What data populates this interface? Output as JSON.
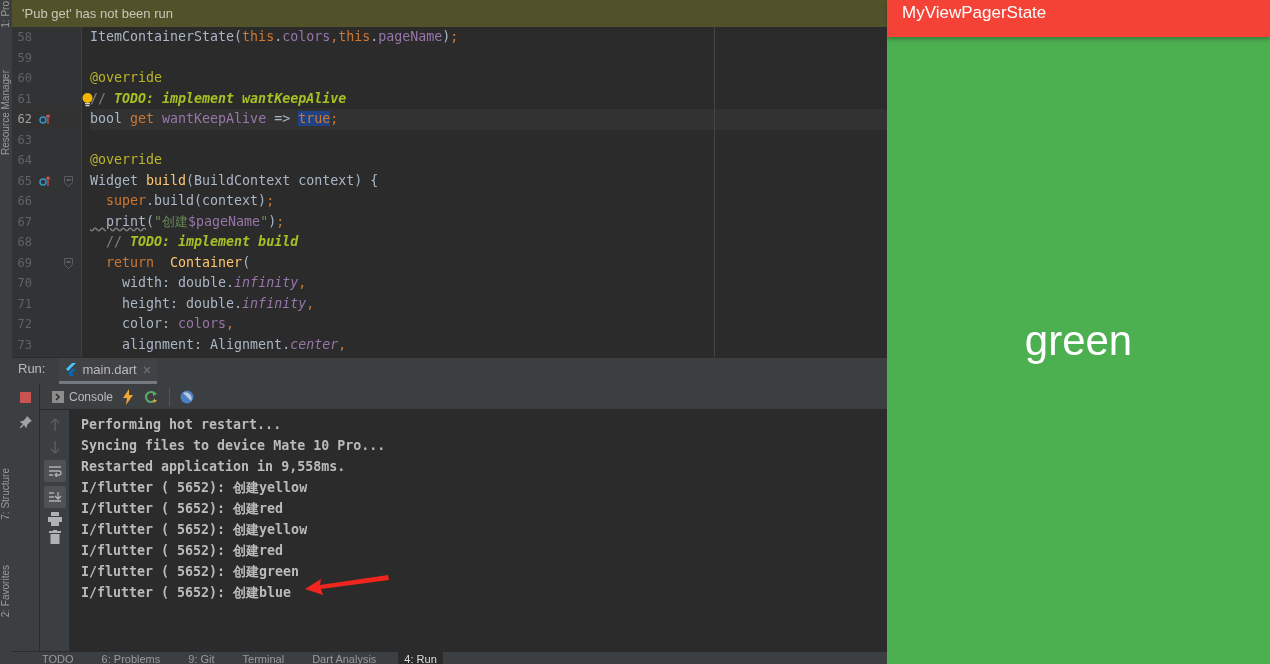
{
  "side_tabs": [
    "1: Pro",
    "Resource Manager",
    "7: Structure",
    "2: Favorites"
  ],
  "banner": "'Pub get' has not been run",
  "code_lines": [
    {
      "number": "58",
      "current": false,
      "override": false,
      "fold": false,
      "bulb": false,
      "segments": [
        {
          "t": "ItemContainerState(",
          "kind": "plain"
        },
        {
          "t": "this",
          "kind": "keyword"
        },
        {
          "t": ".",
          "kind": "plain"
        },
        {
          "t": "colors",
          "kind": "field"
        },
        {
          "t": ",",
          "kind": "keyword"
        },
        {
          "t": "this",
          "kind": "keyword"
        },
        {
          "t": ".",
          "kind": "plain"
        },
        {
          "t": "pageName",
          "kind": "field"
        },
        {
          "t": ")",
          "kind": "plain"
        },
        {
          "t": ";",
          "kind": "keyword"
        }
      ]
    },
    {
      "number": "59",
      "current": false,
      "override": false,
      "fold": false,
      "bulb": false
    },
    {
      "number": "60",
      "current": false,
      "override": false,
      "fold": false,
      "bulb": false,
      "segments": [
        {
          "t": "@override",
          "kind": "annotation"
        }
      ]
    },
    {
      "number": "61",
      "current": false,
      "override": false,
      "fold": false,
      "bulb": true,
      "segments": [
        {
          "t": "//",
          "kind": "comment"
        },
        {
          "t": " TODO: implement wantKeepAlive",
          "kind": "todo"
        }
      ]
    },
    {
      "number": "62",
      "current": true,
      "override": true,
      "fold": false,
      "bulb": false,
      "segments": [
        {
          "t": "bool ",
          "kind": "plain"
        },
        {
          "t": "get ",
          "kind": "keyword"
        },
        {
          "t": "wantKeepAlive",
          "kind": "field"
        },
        {
          "t": " => ",
          "kind": "plain"
        },
        {
          "t": "true",
          "kind": "selected"
        },
        {
          "t": ";",
          "kind": "keyword"
        }
      ]
    },
    {
      "number": "63",
      "current": false,
      "override": false,
      "fold": false,
      "bulb": false
    },
    {
      "number": "64",
      "current": false,
      "override": false,
      "fold": false,
      "bulb": false,
      "segments": [
        {
          "t": "@override",
          "kind": "annotation"
        }
      ]
    },
    {
      "number": "65",
      "current": false,
      "override": true,
      "fold": true,
      "bulb": false,
      "segments": [
        {
          "t": "Widget ",
          "kind": "plain"
        },
        {
          "t": "build",
          "kind": "function"
        },
        {
          "t": "(BuildContext context) {",
          "kind": "plain"
        }
      ]
    },
    {
      "number": "66",
      "current": false,
      "override": false,
      "fold": false,
      "bulb": false,
      "segments": [
        {
          "t": "  super",
          "kind": "keyword"
        },
        {
          "t": ".build(context)",
          "kind": "plain"
        },
        {
          "t": ";",
          "kind": "keyword"
        }
      ]
    },
    {
      "number": "67",
      "current": false,
      "override": false,
      "fold": false,
      "bulb": false,
      "segments": [
        {
          "t": "  print",
          "kind": "warn"
        },
        {
          "t": "(",
          "kind": "plain"
        },
        {
          "t": "\"创建",
          "kind": "string"
        },
        {
          "t": "$pageName",
          "kind": "field"
        },
        {
          "t": "\"",
          "kind": "string"
        },
        {
          "t": ")",
          "kind": "plain"
        },
        {
          "t": ";",
          "kind": "keyword"
        }
      ]
    },
    {
      "number": "68",
      "current": false,
      "override": false,
      "fold": false,
      "bulb": false,
      "segments": [
        {
          "t": "  //",
          "kind": "comment"
        },
        {
          "t": " TODO: implement build",
          "kind": "todo"
        }
      ]
    },
    {
      "number": "69",
      "current": false,
      "override": false,
      "fold": true,
      "bulb": false,
      "segments": [
        {
          "t": "  return  ",
          "kind": "keyword"
        },
        {
          "t": "Container",
          "kind": "function"
        },
        {
          "t": "(",
          "kind": "plain"
        }
      ]
    },
    {
      "number": "70",
      "current": false,
      "override": false,
      "fold": false,
      "bulb": false,
      "segments": [
        {
          "t": "    width: double.",
          "kind": "plain"
        },
        {
          "t": "infinity",
          "kind": "static"
        },
        {
          "t": ",",
          "kind": "keyword"
        }
      ]
    },
    {
      "number": "71",
      "current": false,
      "override": false,
      "fold": false,
      "bulb": false,
      "segments": [
        {
          "t": "    height: double.",
          "kind": "plain"
        },
        {
          "t": "infinity",
          "kind": "static"
        },
        {
          "t": ",",
          "kind": "keyword"
        }
      ]
    },
    {
      "number": "72",
      "current": false,
      "override": false,
      "fold": false,
      "bulb": false,
      "segments": [
        {
          "t": "    color: ",
          "kind": "plain"
        },
        {
          "t": "colors",
          "kind": "field"
        },
        {
          "t": ",",
          "kind": "keyword"
        }
      ]
    },
    {
      "number": "73",
      "current": false,
      "override": false,
      "fold": false,
      "bulb": false,
      "segments": [
        {
          "t": "    alignment: Alignment.",
          "kind": "plain"
        },
        {
          "t": "center",
          "kind": "static"
        },
        {
          "t": ",",
          "kind": "keyword"
        }
      ]
    }
  ],
  "run_panel": {
    "label": "Run:",
    "tabs": [
      {
        "label": "main.dart",
        "selected": true
      }
    ],
    "console_tab": "Console",
    "lines": [
      "Performing hot restart...",
      "Syncing files to device Mate 10 Pro...",
      "Restarted application in 9,558ms.",
      "I/flutter ( 5652): 创建yellow",
      "I/flutter ( 5652): 创建red",
      "I/flutter ( 5652): 创建yellow",
      "I/flutter ( 5652): 创建red",
      "I/flutter ( 5652): 创建green",
      "I/flutter ( 5652): 创建blue"
    ]
  },
  "bottom_tabs": [
    {
      "label": "TODO",
      "selected": false
    },
    {
      "label": "6: Problems",
      "selected": false
    },
    {
      "label": "9: Git",
      "selected": false
    },
    {
      "label": "Terminal",
      "selected": false
    },
    {
      "label": "Dart Analysis",
      "selected": false
    },
    {
      "label": "4: Run",
      "selected": true
    }
  ],
  "phone": {
    "title": "MyViewPagerState",
    "page_text": "green"
  }
}
